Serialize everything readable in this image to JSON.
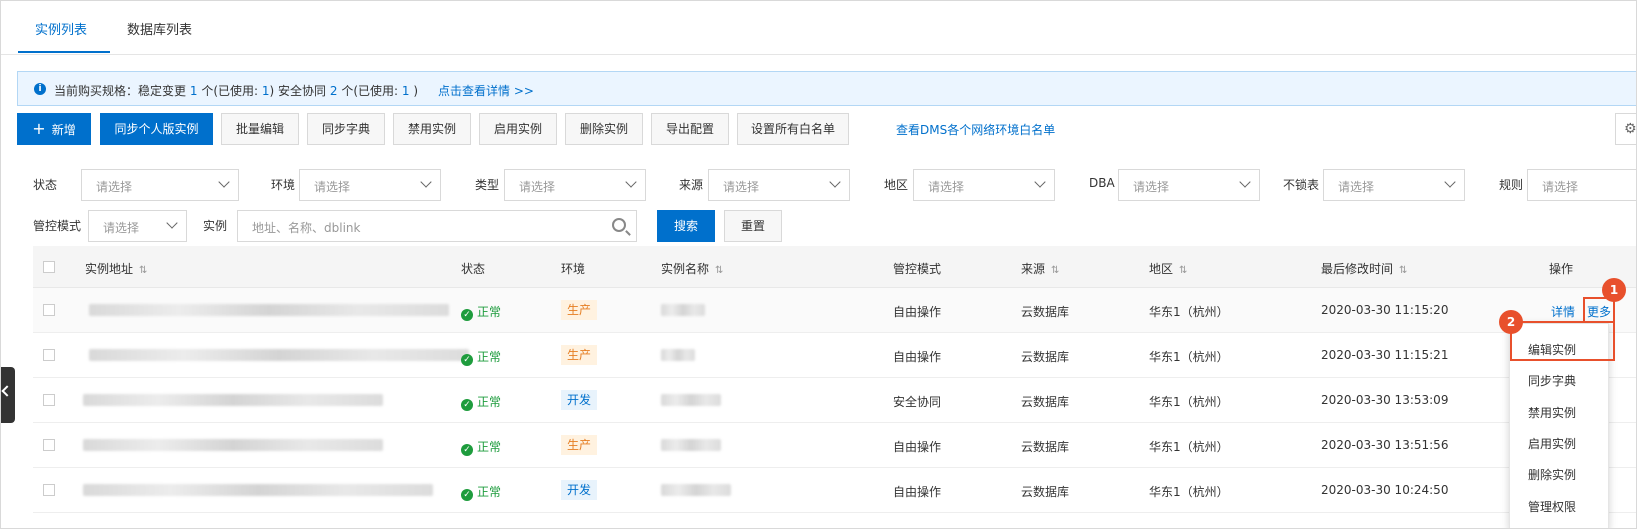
{
  "tabs": [
    {
      "label": "实例列表",
      "active": true
    },
    {
      "label": "数据库列表",
      "active": false
    }
  ],
  "notice": {
    "prefix": "当前购买规格：稳定变更",
    "stable_count": "1",
    "stable_mid": "个(已使用:",
    "stable_used": "1",
    "stable_end": ")",
    "security_label": "安全协同",
    "security_count": "2",
    "security_mid": "个(已使用:",
    "security_used": "1",
    "security_end": ")",
    "link": "点击查看详情 >>"
  },
  "toolbar": {
    "add": "新增",
    "sync_personal": "同步个人版实例",
    "batch_edit": "批量编辑",
    "sync_dict": "同步字典",
    "disable": "禁用实例",
    "enable": "启用实例",
    "delete": "删除实例",
    "export": "导出配置",
    "whitelist": "设置所有白名单",
    "whitelist_link": "查看DMS各个网络环境白名单"
  },
  "filters": {
    "status": "状态",
    "env": "环境",
    "type": "类型",
    "source": "来源",
    "region": "地区",
    "dba": "DBA",
    "nolock": "不锁表",
    "rule": "规则",
    "control_mode": "管控模式",
    "instance": "实例",
    "select_placeholder": "请选择",
    "instance_placeholder": "地址、名称、dblink",
    "search": "搜索",
    "reset": "重置"
  },
  "table": {
    "headers": {
      "address": "实例地址",
      "status": "状态",
      "env": "环境",
      "name": "实例名称",
      "mode": "管控模式",
      "source": "来源",
      "region": "地区",
      "modified": "最后修改时间",
      "action": "操作"
    },
    "rows": [
      {
        "status": "正常",
        "env": "生产",
        "env_kind": "prod",
        "mode": "自由操作",
        "source": "云数据库",
        "region": "华东1（杭州）",
        "modified": "2020-03-30 11:15:20"
      },
      {
        "status": "正常",
        "env": "生产",
        "env_kind": "prod",
        "mode": "自由操作",
        "source": "云数据库",
        "region": "华东1（杭州）",
        "modified": "2020-03-30 11:15:21"
      },
      {
        "status": "正常",
        "env": "开发",
        "env_kind": "dev",
        "mode": "安全协同",
        "source": "云数据库",
        "region": "华东1（杭州）",
        "modified": "2020-03-30 13:53:09"
      },
      {
        "status": "正常",
        "env": "生产",
        "env_kind": "prod",
        "mode": "自由操作",
        "source": "云数据库",
        "region": "华东1（杭州）",
        "modified": "2020-03-30 13:51:56"
      },
      {
        "status": "正常",
        "env": "开发",
        "env_kind": "dev",
        "mode": "自由操作",
        "source": "云数据库",
        "region": "华东1（杭州）",
        "modified": "2020-03-30 10:24:50"
      }
    ],
    "detail": "详情",
    "more": "更多"
  },
  "menu": {
    "items": [
      "编辑实例",
      "同步字典",
      "禁用实例",
      "启用实例",
      "删除实例",
      "管理权限"
    ]
  },
  "steps": [
    "1",
    "2"
  ],
  "colors": {
    "accent": "#0070cc",
    "highlight": "#e8502c",
    "ok": "#1e9c3d"
  }
}
